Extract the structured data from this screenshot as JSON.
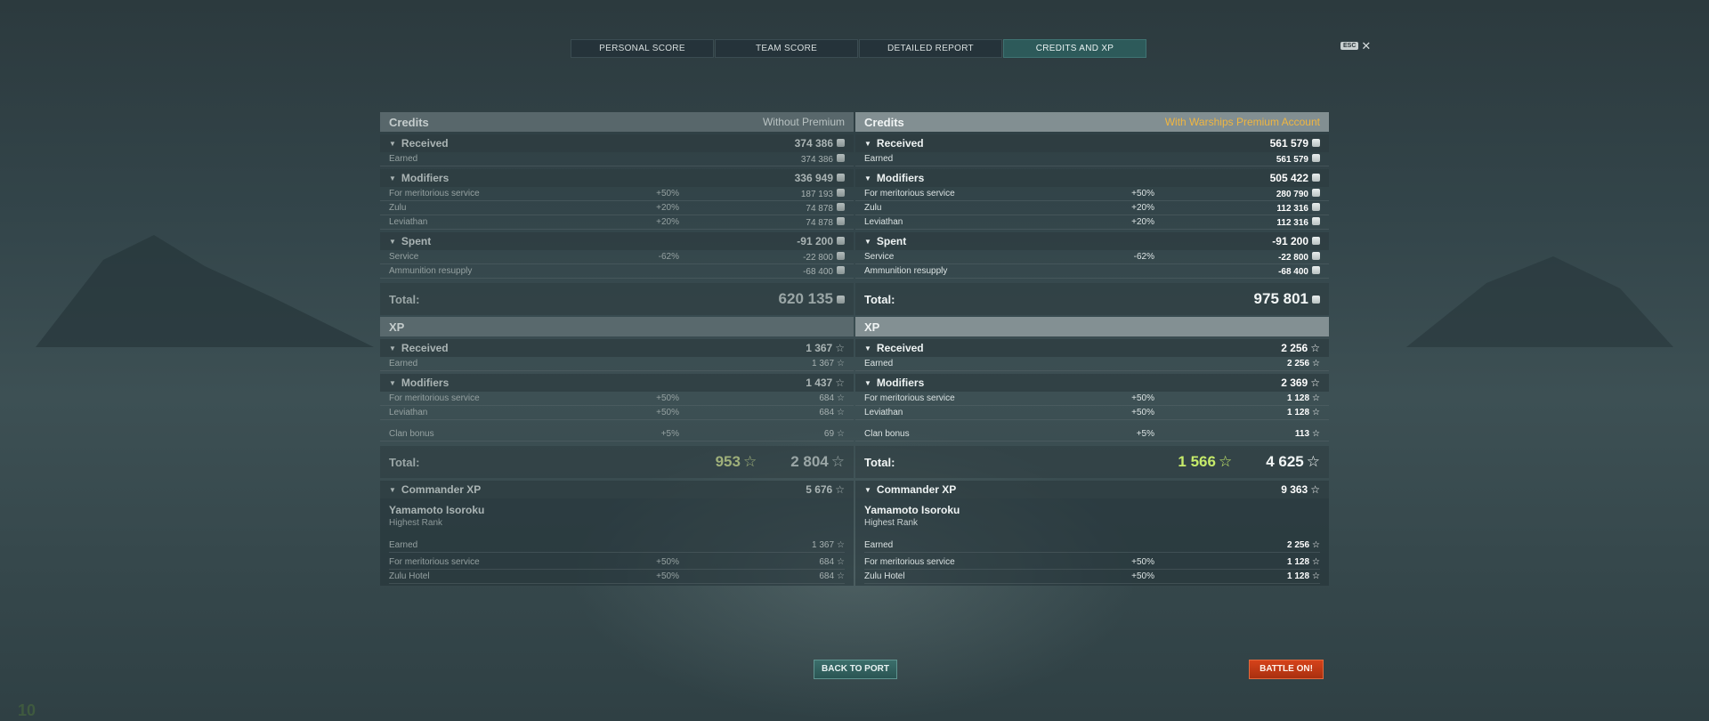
{
  "tabs": [
    {
      "label": "PERSONAL SCORE"
    },
    {
      "label": "TEAM SCORE"
    },
    {
      "label": "DETAILED REPORT"
    },
    {
      "label": "CREDITS AND XP"
    }
  ],
  "esc": {
    "key": "ESC",
    "close": "✕"
  },
  "left": {
    "credits": {
      "title": "Credits",
      "sub": "Without Premium",
      "received": {
        "label": "Received",
        "value": "374 386"
      },
      "earned": {
        "label": "Earned",
        "value": "374 386"
      },
      "modifiers": {
        "label": "Modifiers",
        "value": "336 949"
      },
      "mods": [
        {
          "name": "For meritorious service",
          "pct": "+50%",
          "value": "187 193"
        },
        {
          "name": "Zulu",
          "pct": "+20%",
          "value": "74 878"
        },
        {
          "name": "Leviathan",
          "pct": "+20%",
          "value": "74 878"
        }
      ],
      "spent": {
        "label": "Spent",
        "value": "-91 200"
      },
      "spends": [
        {
          "name": "Service",
          "pct": "-62%",
          "value": "-22 800"
        },
        {
          "name": "Ammunition resupply",
          "pct": "",
          "value": "-68 400"
        }
      ],
      "total": {
        "label": "Total:",
        "value": "620 135"
      }
    },
    "xp": {
      "title": "XP",
      "received": {
        "label": "Received",
        "value": "1 367"
      },
      "earned": {
        "label": "Earned",
        "value": "1 367"
      },
      "modifiers": {
        "label": "Modifiers",
        "value": "1 437"
      },
      "mods": [
        {
          "name": "For meritorious service",
          "pct": "+50%",
          "value": "684"
        },
        {
          "name": "Leviathan",
          "pct": "+50%",
          "value": "684"
        }
      ],
      "clan": {
        "name": "Clan bonus",
        "pct": "+5%",
        "value": "69"
      },
      "total": {
        "label": "Total:",
        "elite": "953",
        "value": "2 804"
      }
    },
    "commander": {
      "title": "Commander XP",
      "value": "5 676",
      "name": "Yamamoto Isoroku",
      "rank": "Highest Rank",
      "rows": [
        {
          "name": "Earned",
          "pct": "",
          "value": "1 367"
        },
        {
          "name": "For meritorious service",
          "pct": "+50%",
          "value": "684"
        },
        {
          "name": "Zulu Hotel",
          "pct": "+50%",
          "value": "684"
        }
      ]
    }
  },
  "right": {
    "credits": {
      "title": "Credits",
      "sub": "With Warships Premium Account",
      "received": {
        "label": "Received",
        "value": "561 579"
      },
      "earned": {
        "label": "Earned",
        "value": "561 579"
      },
      "modifiers": {
        "label": "Modifiers",
        "value": "505 422"
      },
      "mods": [
        {
          "name": "For meritorious service",
          "pct": "+50%",
          "value": "280 790"
        },
        {
          "name": "Zulu",
          "pct": "+20%",
          "value": "112 316"
        },
        {
          "name": "Leviathan",
          "pct": "+20%",
          "value": "112 316"
        }
      ],
      "spent": {
        "label": "Spent",
        "value": "-91 200"
      },
      "spends": [
        {
          "name": "Service",
          "pct": "-62%",
          "value": "-22 800"
        },
        {
          "name": "Ammunition resupply",
          "pct": "",
          "value": "-68 400"
        }
      ],
      "total": {
        "label": "Total:",
        "value": "975 801"
      }
    },
    "xp": {
      "title": "XP",
      "received": {
        "label": "Received",
        "value": "2 256"
      },
      "earned": {
        "label": "Earned",
        "value": "2 256"
      },
      "modifiers": {
        "label": "Modifiers",
        "value": "2 369"
      },
      "mods": [
        {
          "name": "For meritorious service",
          "pct": "+50%",
          "value": "1 128"
        },
        {
          "name": "Leviathan",
          "pct": "+50%",
          "value": "1 128"
        }
      ],
      "clan": {
        "name": "Clan bonus",
        "pct": "+5%",
        "value": "113"
      },
      "total": {
        "label": "Total:",
        "elite": "1 566",
        "value": "4 625"
      }
    },
    "commander": {
      "title": "Commander XP",
      "value": "9 363",
      "name": "Yamamoto Isoroku",
      "rank": "Highest Rank",
      "rows": [
        {
          "name": "Earned",
          "pct": "",
          "value": "2 256"
        },
        {
          "name": "For meritorious service",
          "pct": "+50%",
          "value": "1 128"
        },
        {
          "name": "Zulu Hotel",
          "pct": "+50%",
          "value": "1 128"
        }
      ]
    }
  },
  "buttons": {
    "back": "BACK TO PORT",
    "battle": "BATTLE ON!"
  },
  "corner_number": "10",
  "colors": {
    "premium_accent": "#f0b640",
    "elite_xp": "#c6eb6a",
    "battle_button": "#d5421a",
    "port_button": "#3b6e6b"
  }
}
